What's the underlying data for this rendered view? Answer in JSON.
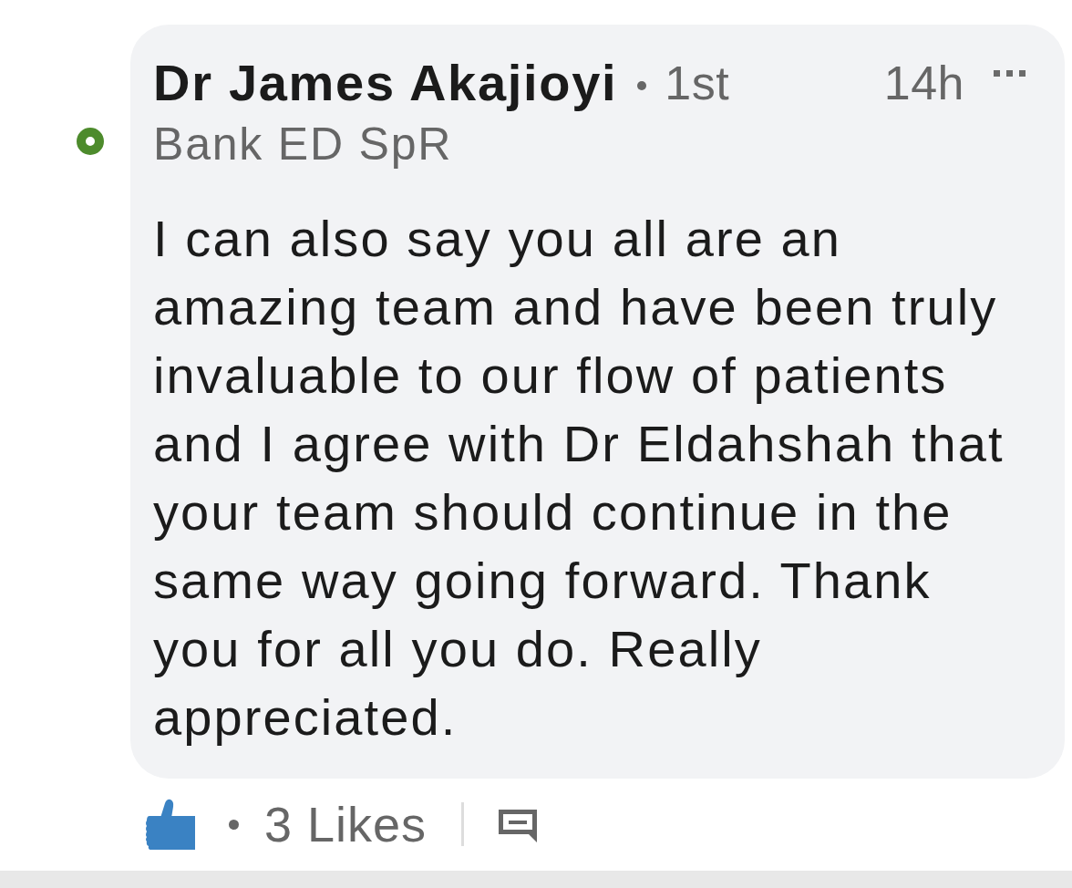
{
  "comment": {
    "author": {
      "name": "Dr James Akajioyi",
      "connection": "1st",
      "headline": "Bank ED SpR",
      "online": true
    },
    "time": "14h",
    "text": "I can also say you all are an amazing team and have been truly invaluable to our flow of patients and I agree with Dr Eldahshah that your team should continue in the same way going forward. Thank you for all you do. Really appreciated.",
    "likes": "3 Likes"
  }
}
